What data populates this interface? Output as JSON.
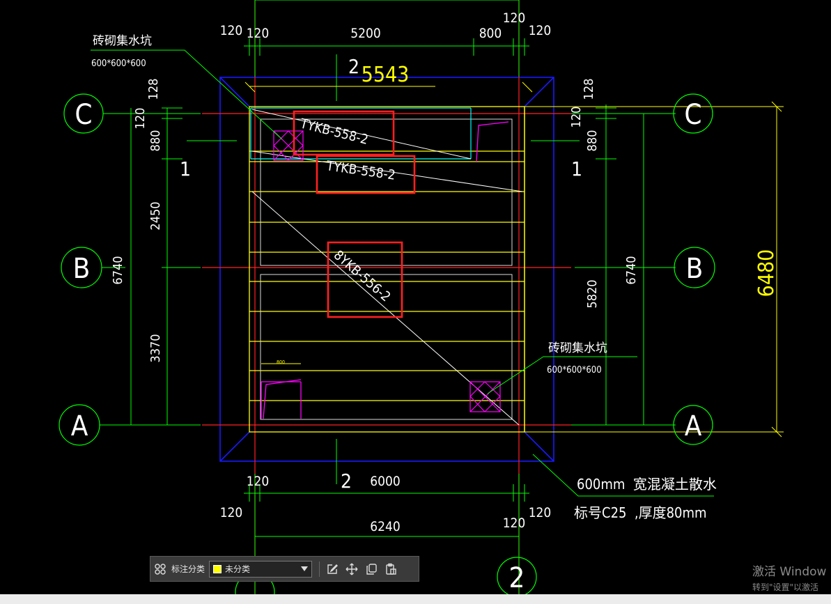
{
  "drawing": {
    "axes": {
      "C": "C",
      "B": "B",
      "A": "A",
      "col2": "2"
    },
    "section_marks": {
      "s1_left": "1",
      "s1_right": "1",
      "s2_top": "2",
      "s2_bottom": "2"
    },
    "top_dims": {
      "t120a": "120",
      "t120b": "120",
      "t5200": "5200",
      "t800": "800",
      "t120c": "120",
      "t120d": "120"
    },
    "top_big_dim": "5543",
    "bottom_dims": {
      "b120a": "120",
      "b6000": "6000",
      "b120b": "120",
      "b6240": "6240",
      "b120c": "120",
      "b120d": "120"
    },
    "left_dims": {
      "l128": "128",
      "l120": "120",
      "l880": "880",
      "l2450": "2450",
      "l6740": "6740",
      "l3370": "3370"
    },
    "right_dims": {
      "r128": "128",
      "r120": "120",
      "r880": "880",
      "r5820": "5820",
      "r6740": "6740"
    },
    "right_big_dim": "6480",
    "slabs": {
      "s1": "TYKB-558-2",
      "s2": "TYKB-558-2",
      "s3": "8YKB-556-2"
    },
    "notes": {
      "pit_top_title": "砖砌集水坑",
      "pit_top_size": "600*600*600",
      "pit_bottom_title": "砖砌集水坑",
      "pit_bottom_size": "600*600*600",
      "apron_1": "600mm  宽混凝土散水",
      "apron_2": "标号C25  ,厚度80mm",
      "small_800": "800"
    }
  },
  "toolbar": {
    "category_label": "标注分类",
    "category_value": "未分类",
    "swatch_color": "#ffff00"
  },
  "watermark": {
    "line1": "激活 Window",
    "line2": "转到\"设置\"以激活"
  },
  "colors": {
    "axis": "#00ff00",
    "wall": "#ffff00",
    "grid": "#ff0000",
    "outline": "#0000ff",
    "highlight": "#ff2020",
    "pit": "#ff00ff",
    "text": "#ffffff"
  }
}
